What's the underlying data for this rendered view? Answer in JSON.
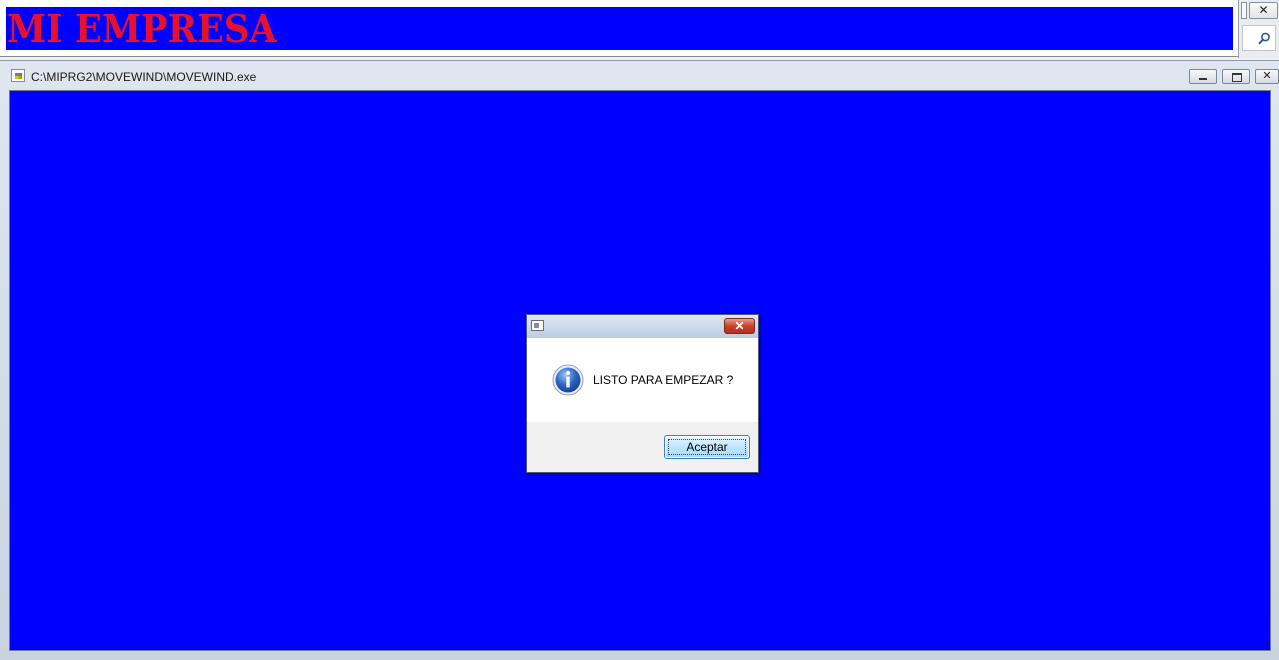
{
  "banner": {
    "title": "MI EMPRESA",
    "background": "#0000ff",
    "title_color": "#e8102a"
  },
  "right_strip": {
    "close_glyph": "✕",
    "search_icon": "search-icon"
  },
  "window": {
    "title": "C:\\MIPRG2\\MOVEWIND\\MOVEWIND.exe",
    "client_background": "#0000ff",
    "controls": {
      "minimize_icon": "minimize-icon",
      "restore_icon": "restore-icon",
      "close_glyph": "✕"
    }
  },
  "dialog": {
    "close_glyph": "✕",
    "icon": "information-icon",
    "message": "LISTO PARA EMPEZAR ?",
    "ok_label": "Aceptar"
  }
}
